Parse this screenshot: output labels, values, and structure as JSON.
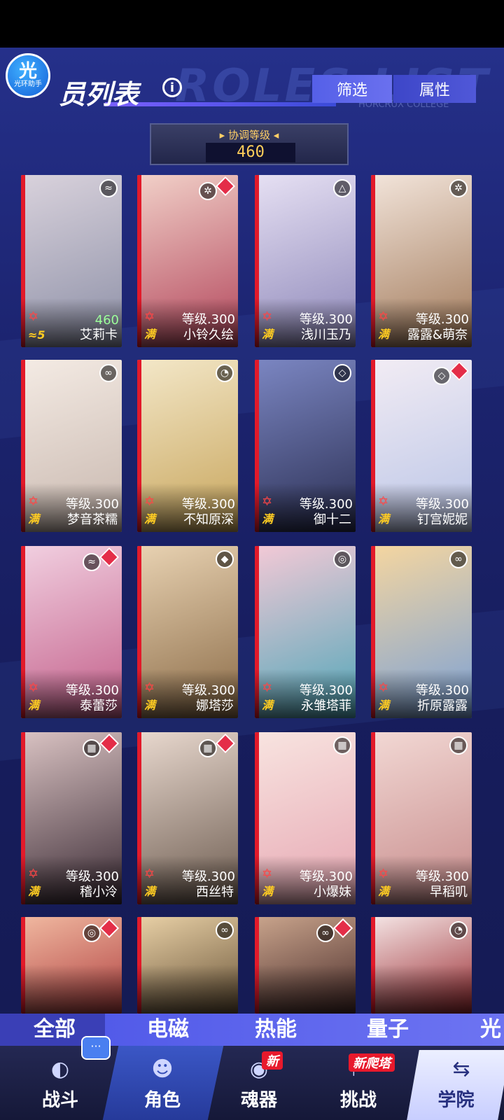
{
  "header": {
    "title": "员列表",
    "ghost_text": "ROLES LIST",
    "ghost_sub": "HORCRUX COLLEGE",
    "logo_glyph": "光",
    "logo_text": "光环助手",
    "filter_label": "筛选",
    "attr_label": "属性"
  },
  "coordination": {
    "label": "协调等级",
    "value": "460"
  },
  "characters": [
    {
      "name": "艾莉卡",
      "level": "460",
      "max": "≈5",
      "element": "wave-icon",
      "highlight": true
    },
    {
      "name": "小铃久绘",
      "level": "等级.300",
      "max": "满",
      "element": "snow-icon",
      "badge": true
    },
    {
      "name": "浅川玉乃",
      "level": "等级.300",
      "max": "满",
      "element": "triangle-icon"
    },
    {
      "name": "露露&萌奈",
      "level": "等级.300",
      "max": "满",
      "element": "snow-icon"
    },
    {
      "name": "梦音茶糯",
      "level": "等级.300",
      "max": "满",
      "element": "link-icon"
    },
    {
      "name": "不知原深",
      "level": "等级.300",
      "max": "满",
      "element": "wifi-icon"
    },
    {
      "name": "御十二",
      "level": "等级.300",
      "max": "满",
      "element": "diamond-icon"
    },
    {
      "name": "钉宫妮妮",
      "level": "等级.300",
      "max": "满",
      "element": "diamond-icon",
      "badge": true
    },
    {
      "name": "泰蕾莎",
      "level": "等级.300",
      "max": "满",
      "element": "wave-icon",
      "badge": true
    },
    {
      "name": "娜塔莎",
      "level": "等级.300",
      "max": "满",
      "element": "shield-icon"
    },
    {
      "name": "永雏塔菲",
      "level": "等级.300",
      "max": "满",
      "element": "spiral-icon"
    },
    {
      "name": "折原露露",
      "level": "等级.300",
      "max": "满",
      "element": "link-icon"
    },
    {
      "name": "稽小泠",
      "level": "等级.300",
      "max": "满",
      "element": "grid-icon",
      "badge": true
    },
    {
      "name": "西丝特",
      "level": "等级.300",
      "max": "满",
      "element": "grid-icon",
      "badge": true
    },
    {
      "name": "小爆妹",
      "level": "等级.300",
      "max": "满",
      "element": "grid-icon"
    },
    {
      "name": "早稻叽",
      "level": "等级.300",
      "max": "满",
      "element": "grid-icon"
    },
    {
      "name": "",
      "level": "",
      "max": "",
      "element": "spiral-icon",
      "badge": true
    },
    {
      "name": "",
      "level": "",
      "max": "",
      "element": "link-icon"
    },
    {
      "name": "",
      "level": "",
      "max": "",
      "element": "link-icon",
      "badge": true
    },
    {
      "name": "",
      "level": "",
      "max": "",
      "element": "wifi-icon"
    }
  ],
  "element_tabs": [
    "全部",
    "电磁",
    "热能",
    "量子",
    "光"
  ],
  "nav": {
    "items": [
      "战斗",
      "角色",
      "魂器",
      "挑战",
      "学院"
    ],
    "new_tag": "新",
    "new_tower_tag": "新爬塔",
    "chat": "···"
  },
  "colors": {
    "accent": "#5560e8",
    "red": "#e21a2a",
    "gold": "#ffcc22"
  }
}
